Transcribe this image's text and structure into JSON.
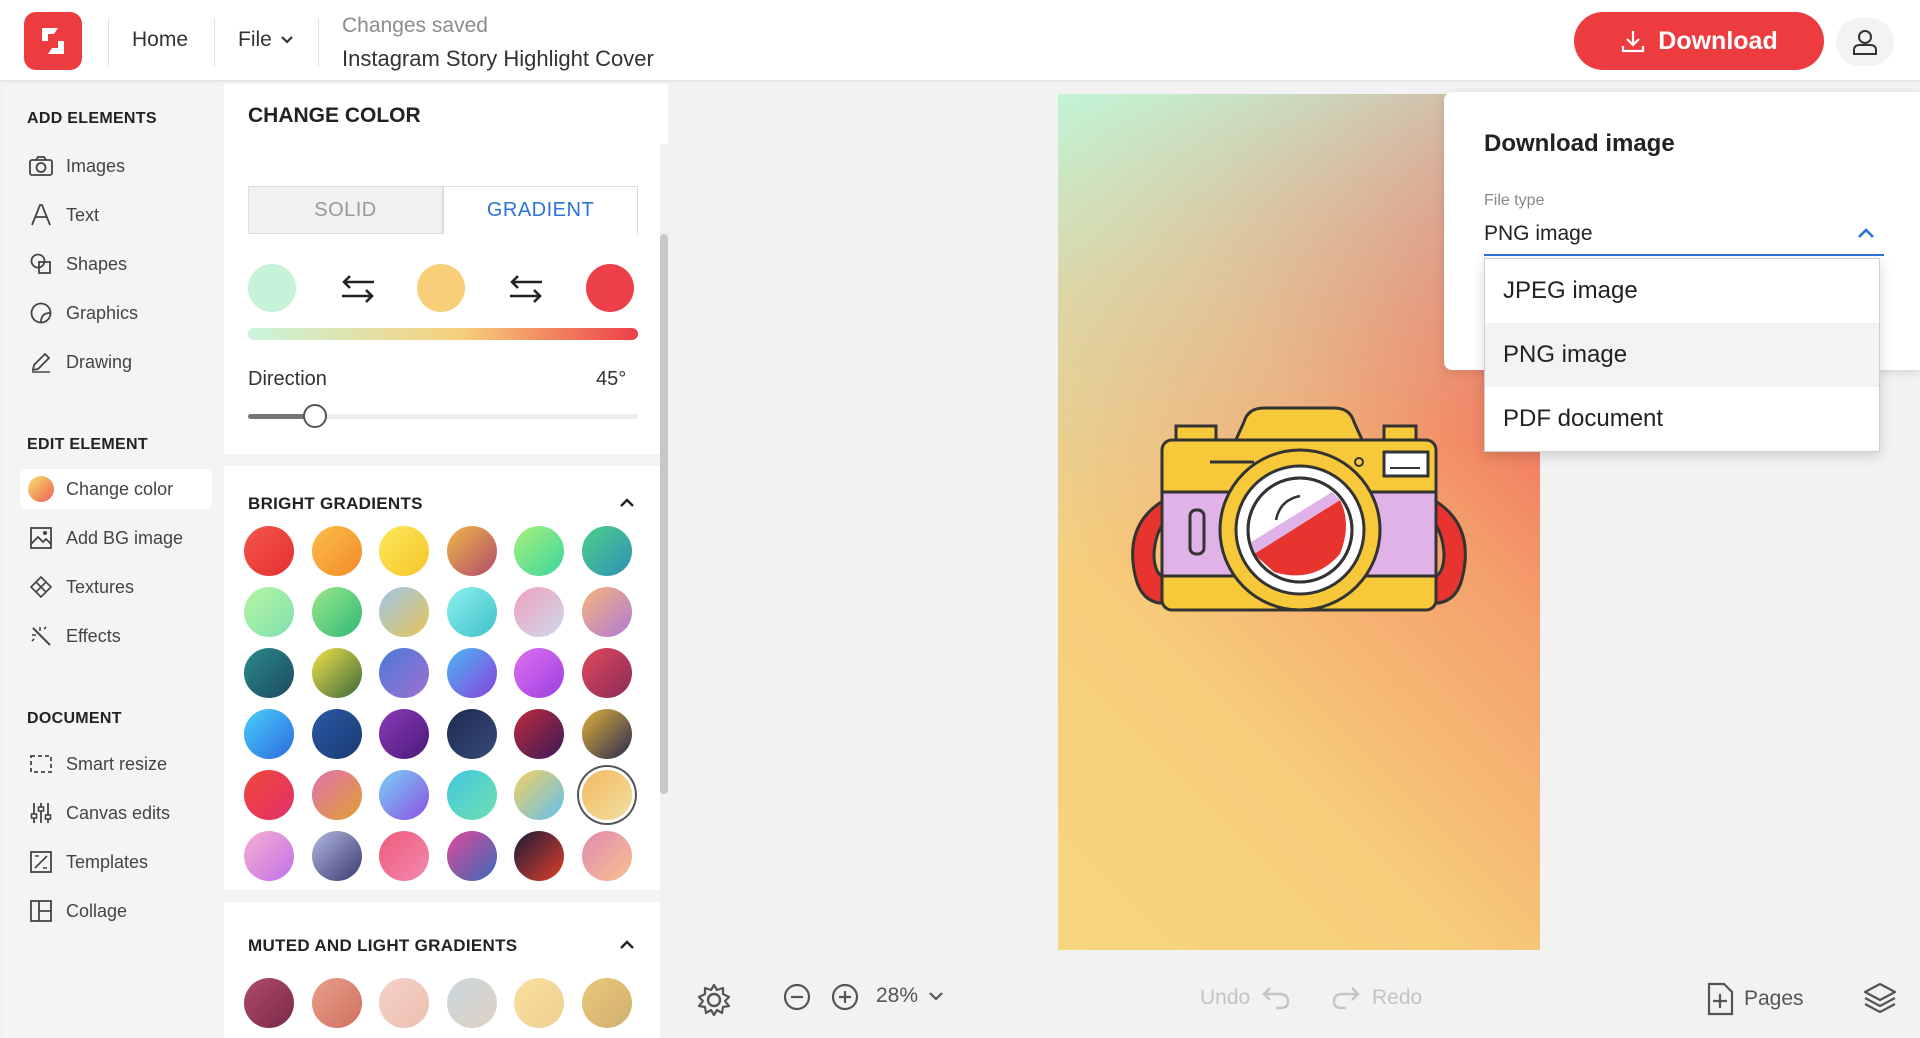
{
  "topbar": {
    "home_label": "Home",
    "file_label": "File",
    "status_text": "Changes saved",
    "document_title": "Instagram Story Highlight Cover",
    "download_label": "Download"
  },
  "leftnav": {
    "add_title": "ADD ELEMENTS",
    "add_items": [
      {
        "label": "Images",
        "icon": "camera-icon"
      },
      {
        "label": "Text",
        "icon": "text-icon"
      },
      {
        "label": "Shapes",
        "icon": "shapes-icon"
      },
      {
        "label": "Graphics",
        "icon": "graphics-icon"
      },
      {
        "label": "Drawing",
        "icon": "pencil-icon"
      }
    ],
    "edit_title": "EDIT ELEMENT",
    "edit_items": [
      {
        "label": "Change color",
        "icon": "color-circle-icon",
        "active": true
      },
      {
        "label": "Add BG image",
        "icon": "bg-image-icon"
      },
      {
        "label": "Textures",
        "icon": "textures-icon"
      },
      {
        "label": "Effects",
        "icon": "magic-wand-icon"
      }
    ],
    "doc_title": "DOCUMENT",
    "doc_items": [
      {
        "label": "Smart resize",
        "icon": "resize-icon"
      },
      {
        "label": "Canvas edits",
        "icon": "sliders-icon"
      },
      {
        "label": "Templates",
        "icon": "templates-icon"
      },
      {
        "label": "Collage",
        "icon": "collage-icon"
      }
    ]
  },
  "panel": {
    "title": "CHANGE COLOR",
    "tab_solid": "SOLID",
    "tab_gradient": "GRADIENT",
    "gradient_stops": [
      "#c6f3d8",
      "#f8cf78",
      "#ec3f49"
    ],
    "direction_label": "Direction",
    "direction_value": "45°",
    "direction_fraction": 0.15,
    "bright_title": "BRIGHT GRADIENTS",
    "muted_title": "MUTED AND LIGHT GRADIENTS",
    "bright_swatches": [
      [
        "#f2574a",
        "#e52f2f"
      ],
      [
        "#fbbf4a",
        "#f28a27"
      ],
      [
        "#fde85a",
        "#f5c52a"
      ],
      [
        "#f0b84a",
        "#b04a6a"
      ],
      [
        "#a8f07a",
        "#3bd6a0"
      ],
      [
        "#4fd18a",
        "#2e8fb5"
      ],
      [
        "#b7f5a0",
        "#7ee0b0"
      ],
      [
        "#9be88a",
        "#2fb878"
      ],
      [
        "#9ec6e8",
        "#e7c45a"
      ],
      [
        "#8ef0f0",
        "#3ec0c8"
      ],
      [
        "#f0a0c0",
        "#cfd9e8"
      ],
      [
        "#f6b47a",
        "#b07ad8"
      ],
      [
        "#2a8a8a",
        "#1e4a60"
      ],
      [
        "#f2e24a",
        "#3a6a3a"
      ],
      [
        "#4a7ad8",
        "#a070d0"
      ],
      [
        "#4ab8f0",
        "#8a40e0"
      ],
      [
        "#e070f0",
        "#9a40e0"
      ],
      [
        "#e04a5a",
        "#8a2a5a"
      ],
      [
        "#4ad0f8",
        "#2a6ae0"
      ],
      [
        "#2a5aa8",
        "#1a3a70"
      ],
      [
        "#8a3ab8",
        "#4a1a7a"
      ],
      [
        "#1a2a50",
        "#3a4a7a"
      ],
      [
        "#c02a3a",
        "#3a1a5a"
      ],
      [
        "#e0b03a",
        "#2a2a50"
      ],
      [
        "#f0483a",
        "#e0306a"
      ],
      [
        "#e070b0",
        "#e0a030"
      ],
      [
        "#7ad0f8",
        "#8a50e0"
      ],
      [
        "#40c8e0",
        "#70e0b0"
      ],
      [
        "#f5d060",
        "#60c0f0"
      ],
      [
        "#f5b860",
        "#f0e0a0"
      ],
      [
        "#f8b0d0",
        "#c070e8"
      ],
      [
        "#b0b8e0",
        "#3a3a70"
      ],
      [
        "#f05a7a",
        "#f08ab0"
      ],
      [
        "#e04a9a",
        "#3a6ab8"
      ],
      [
        "#1a1a3a",
        "#e0402a"
      ],
      [
        "#e08ab0",
        "#f8c090"
      ]
    ],
    "muted_swatches": [
      [
        "#b04a6a",
        "#7a2a4a"
      ],
      [
        "#e8a08a",
        "#d07060"
      ],
      [
        "#f5d0c8",
        "#ecc0b0"
      ],
      [
        "#c8d8e0",
        "#e0d0c0"
      ],
      [
        "#f8e0a0",
        "#f0d090"
      ],
      [
        "#e8c878",
        "#d0b070"
      ]
    ],
    "selected_swatch_index": 29
  },
  "download_popup": {
    "title": "Download image",
    "filetype_label": "File type",
    "selected_value": "PNG image",
    "options": [
      "JPEG image",
      "PNG image",
      "PDF document"
    ],
    "highlighted_option_index": 1
  },
  "bottombar": {
    "zoom_value": "28%",
    "undo_label": "Undo",
    "redo_label": "Redo",
    "pages_label": "Pages"
  }
}
